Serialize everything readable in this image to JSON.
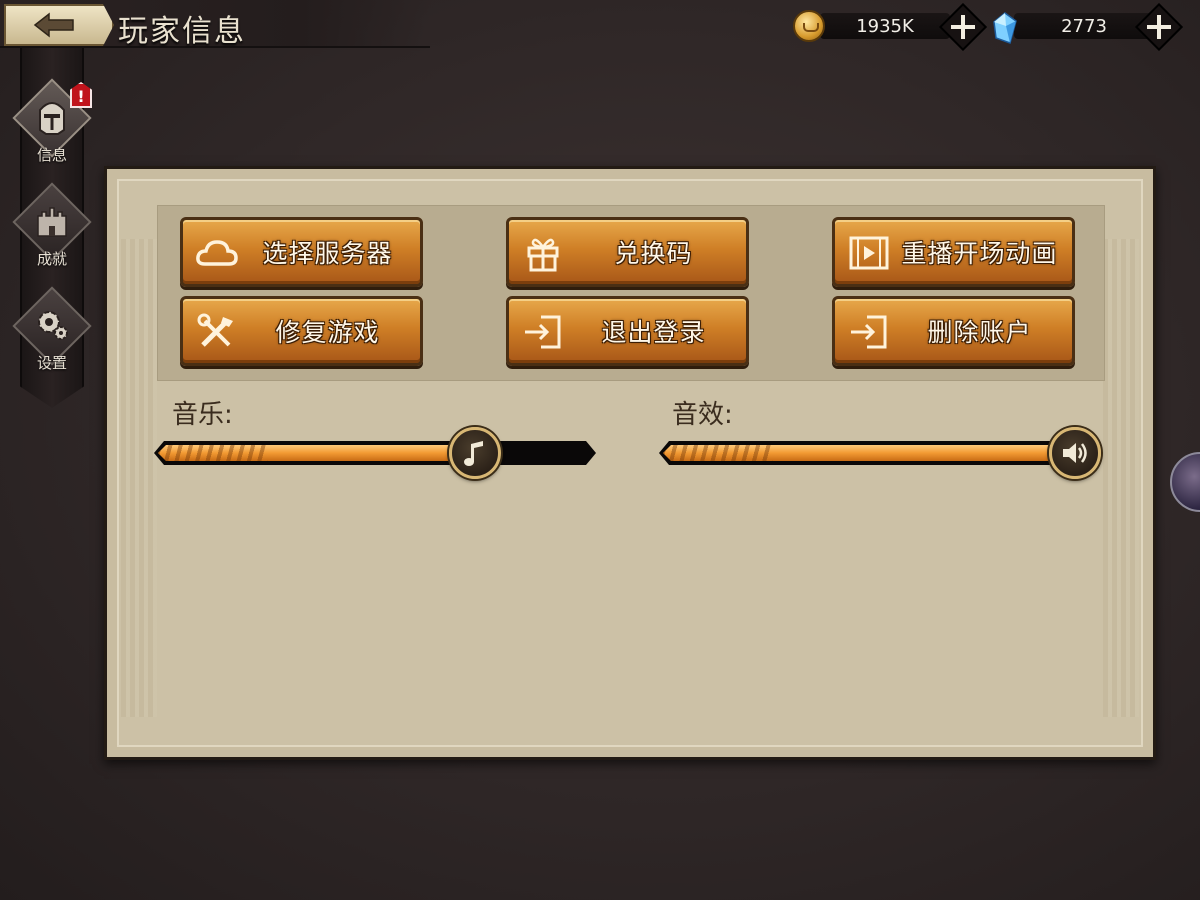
{
  "header": {
    "title": "玩家信息"
  },
  "currency": {
    "gold": "1935K",
    "gems": "2773"
  },
  "sidebar": {
    "items": [
      {
        "label": "信息",
        "active": true,
        "alert": "!"
      },
      {
        "label": "成就",
        "active": false
      },
      {
        "label": "设置",
        "active": false
      }
    ]
  },
  "buttons": {
    "select_server": "选择服务器",
    "redeem_code": "兑换码",
    "replay_intro": "重播开场动画",
    "repair_game": "修复游戏",
    "logout": "退出登录",
    "delete_account": "删除账户"
  },
  "audio": {
    "music_label": "音乐:",
    "sfx_label": "音效:",
    "music_level": 0.75,
    "sfx_level": 1.0
  },
  "colors": {
    "button_orange": "#cf7f26",
    "slider_fill": "#f29a33",
    "panel_parchment": "#ccc1a6",
    "alert_red": "#c0141c"
  }
}
